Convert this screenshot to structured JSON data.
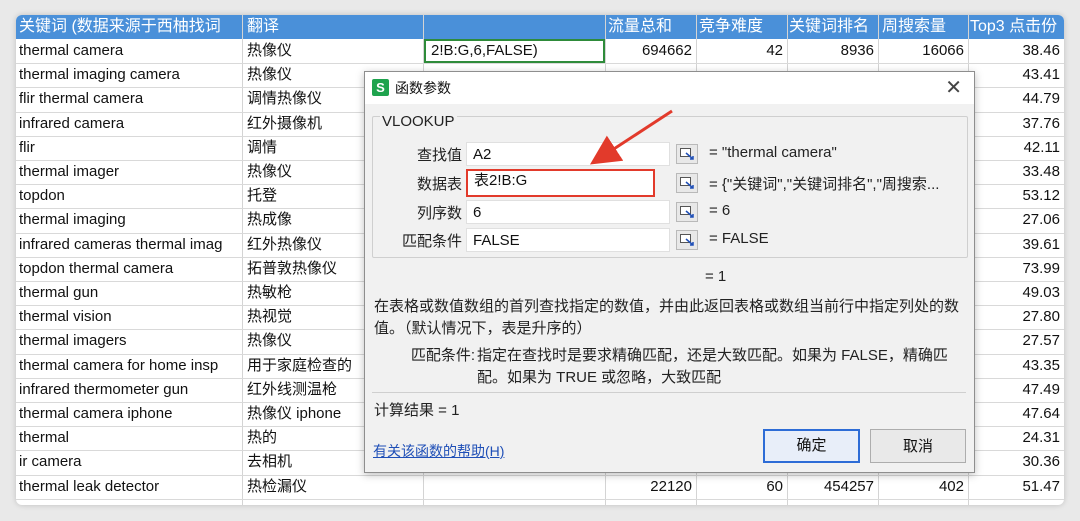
{
  "sheet": {
    "columns": [
      "关键词 (数据来源于西柚找词",
      "翻译",
      "",
      "流量总和",
      "竞争难度",
      "关键词排名",
      "周搜索量",
      "Top3 点击份"
    ],
    "active_cell_value": "2!B:G,6,FALSE)",
    "rows": [
      {
        "keyword": "thermal camera",
        "translation": "热像仪",
        "c3": "",
        "traffic": "694662",
        "difficulty": "42",
        "rank": "8936",
        "weekly": "16066",
        "top3": "38.46"
      },
      {
        "keyword": "thermal imaging camera",
        "translation": "热像仪",
        "top3": "43.41"
      },
      {
        "keyword": "flir thermal camera",
        "translation": "调情热像仪",
        "top3": "44.79"
      },
      {
        "keyword": "infrared camera",
        "translation": "红外摄像机",
        "top3": "37.76"
      },
      {
        "keyword": "flir",
        "translation": "调情",
        "top3": "42.11"
      },
      {
        "keyword": "thermal imager",
        "translation": "热像仪",
        "top3": "33.48"
      },
      {
        "keyword": "topdon",
        "translation": "托登",
        "top3": "53.12"
      },
      {
        "keyword": "thermal imaging",
        "translation": "热成像",
        "top3": "27.06"
      },
      {
        "keyword": "infrared cameras thermal imag",
        "translation": "红外热像仪",
        "top3": "39.61"
      },
      {
        "keyword": "topdon thermal camera",
        "translation": "拓普敦热像仪",
        "top3": "73.99"
      },
      {
        "keyword": "thermal gun",
        "translation": "热敏枪",
        "top3": "49.03"
      },
      {
        "keyword": "thermal vision",
        "translation": "热视觉",
        "top3": "27.80"
      },
      {
        "keyword": "thermal imagers",
        "translation": "热像仪",
        "top3": "27.57"
      },
      {
        "keyword": "thermal camera for home insp",
        "translation": "用于家庭检查的",
        "top3": "43.35"
      },
      {
        "keyword": "infrared thermometer gun",
        "translation": "红外线测温枪",
        "top3": "47.49"
      },
      {
        "keyword": "thermal camera iphone",
        "translation": "热像仪 iphone",
        "top3": "47.64"
      },
      {
        "keyword": "thermal",
        "translation": "热的",
        "top3": "24.31"
      },
      {
        "keyword": "ir camera",
        "translation": "去相机",
        "top3": "30.36"
      },
      {
        "keyword": "thermal leak detector",
        "translation": "热检漏仪",
        "traffic": "22120",
        "difficulty": "60",
        "rank": "454257",
        "weekly": "402",
        "top3": "51.47"
      }
    ]
  },
  "dialog": {
    "app_icon_letter": "S",
    "title": "函数参数",
    "function_name": "VLOOKUP",
    "fields": [
      {
        "label": "查找值",
        "value": "A2",
        "result": "= \"thermal camera\""
      },
      {
        "label": "数据表",
        "value": "表2!B:G",
        "result": "= {\"关键词\",\"关键词排名\",\"周搜索..."
      },
      {
        "label": "列序数",
        "value": "6",
        "result": "= 6"
      },
      {
        "label": "匹配条件",
        "value": "FALSE",
        "result": "= FALSE"
      }
    ],
    "overall_result": "= 1",
    "description": "在表格或数值数组的首列查找指定的数值，并由此返回表格或数组当前行中指定列处的数值。（默认情况下，表是升序的）",
    "param_label": "匹配条件:",
    "param_desc": "指定在查找时是要求精确匹配，还是大致匹配。如果为 FALSE，精确匹配。如果为 TRUE 或忽略，大致匹配",
    "calc_result": "计算结果 = 1",
    "help_link": "有关该函数的帮助(H)",
    "ok_label": "确定",
    "cancel_label": "取消"
  },
  "colors": {
    "header_bg": "#4a90d9",
    "highlight": "#e23a2b",
    "cell_border": "#2e8b3a",
    "link": "#1f4fb7"
  }
}
